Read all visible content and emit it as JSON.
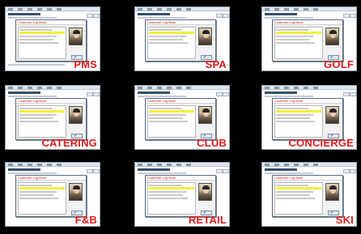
{
  "tiles": [
    {
      "label": "PMS"
    },
    {
      "label": "SPA"
    },
    {
      "label": "GOLF"
    },
    {
      "label": "CATERING"
    },
    {
      "label": "CLUB"
    },
    {
      "label": "CONCIERGE"
    },
    {
      "label": "F&B"
    },
    {
      "label": "RETAIL"
    },
    {
      "label": "SKI"
    }
  ],
  "dialog": {
    "title": "Customer Log Book"
  },
  "ok_glyph": "✔",
  "colors": {
    "label": "#e01b1b",
    "highlight_row": "#f4ee3a",
    "background": "#000000"
  }
}
